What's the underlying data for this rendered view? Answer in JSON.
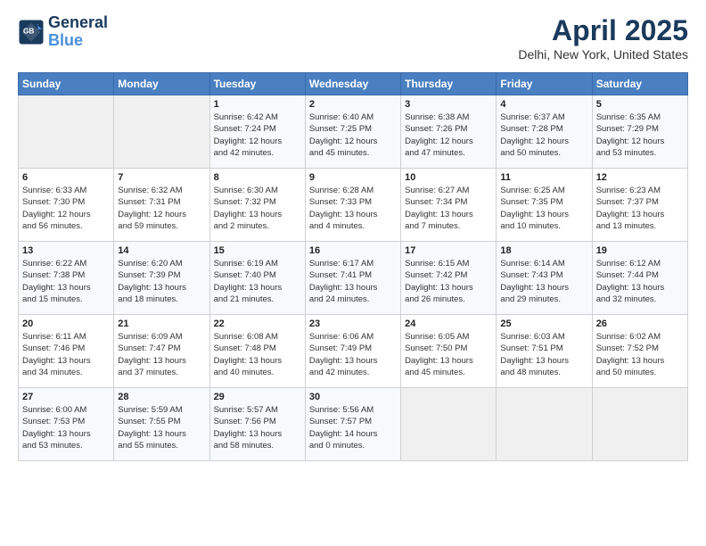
{
  "logo": {
    "line1": "General",
    "line2": "Blue"
  },
  "title": "April 2025",
  "subtitle": "Delhi, New York, United States",
  "days_of_week": [
    "Sunday",
    "Monday",
    "Tuesday",
    "Wednesday",
    "Thursday",
    "Friday",
    "Saturday"
  ],
  "weeks": [
    [
      {
        "day": "",
        "content": ""
      },
      {
        "day": "",
        "content": ""
      },
      {
        "day": "1",
        "content": "Sunrise: 6:42 AM\nSunset: 7:24 PM\nDaylight: 12 hours\nand 42 minutes."
      },
      {
        "day": "2",
        "content": "Sunrise: 6:40 AM\nSunset: 7:25 PM\nDaylight: 12 hours\nand 45 minutes."
      },
      {
        "day": "3",
        "content": "Sunrise: 6:38 AM\nSunset: 7:26 PM\nDaylight: 12 hours\nand 47 minutes."
      },
      {
        "day": "4",
        "content": "Sunrise: 6:37 AM\nSunset: 7:28 PM\nDaylight: 12 hours\nand 50 minutes."
      },
      {
        "day": "5",
        "content": "Sunrise: 6:35 AM\nSunset: 7:29 PM\nDaylight: 12 hours\nand 53 minutes."
      }
    ],
    [
      {
        "day": "6",
        "content": "Sunrise: 6:33 AM\nSunset: 7:30 PM\nDaylight: 12 hours\nand 56 minutes."
      },
      {
        "day": "7",
        "content": "Sunrise: 6:32 AM\nSunset: 7:31 PM\nDaylight: 12 hours\nand 59 minutes."
      },
      {
        "day": "8",
        "content": "Sunrise: 6:30 AM\nSunset: 7:32 PM\nDaylight: 13 hours\nand 2 minutes."
      },
      {
        "day": "9",
        "content": "Sunrise: 6:28 AM\nSunset: 7:33 PM\nDaylight: 13 hours\nand 4 minutes."
      },
      {
        "day": "10",
        "content": "Sunrise: 6:27 AM\nSunset: 7:34 PM\nDaylight: 13 hours\nand 7 minutes."
      },
      {
        "day": "11",
        "content": "Sunrise: 6:25 AM\nSunset: 7:35 PM\nDaylight: 13 hours\nand 10 minutes."
      },
      {
        "day": "12",
        "content": "Sunrise: 6:23 AM\nSunset: 7:37 PM\nDaylight: 13 hours\nand 13 minutes."
      }
    ],
    [
      {
        "day": "13",
        "content": "Sunrise: 6:22 AM\nSunset: 7:38 PM\nDaylight: 13 hours\nand 15 minutes."
      },
      {
        "day": "14",
        "content": "Sunrise: 6:20 AM\nSunset: 7:39 PM\nDaylight: 13 hours\nand 18 minutes."
      },
      {
        "day": "15",
        "content": "Sunrise: 6:19 AM\nSunset: 7:40 PM\nDaylight: 13 hours\nand 21 minutes."
      },
      {
        "day": "16",
        "content": "Sunrise: 6:17 AM\nSunset: 7:41 PM\nDaylight: 13 hours\nand 24 minutes."
      },
      {
        "day": "17",
        "content": "Sunrise: 6:15 AM\nSunset: 7:42 PM\nDaylight: 13 hours\nand 26 minutes."
      },
      {
        "day": "18",
        "content": "Sunrise: 6:14 AM\nSunset: 7:43 PM\nDaylight: 13 hours\nand 29 minutes."
      },
      {
        "day": "19",
        "content": "Sunrise: 6:12 AM\nSunset: 7:44 PM\nDaylight: 13 hours\nand 32 minutes."
      }
    ],
    [
      {
        "day": "20",
        "content": "Sunrise: 6:11 AM\nSunset: 7:46 PM\nDaylight: 13 hours\nand 34 minutes."
      },
      {
        "day": "21",
        "content": "Sunrise: 6:09 AM\nSunset: 7:47 PM\nDaylight: 13 hours\nand 37 minutes."
      },
      {
        "day": "22",
        "content": "Sunrise: 6:08 AM\nSunset: 7:48 PM\nDaylight: 13 hours\nand 40 minutes."
      },
      {
        "day": "23",
        "content": "Sunrise: 6:06 AM\nSunset: 7:49 PM\nDaylight: 13 hours\nand 42 minutes."
      },
      {
        "day": "24",
        "content": "Sunrise: 6:05 AM\nSunset: 7:50 PM\nDaylight: 13 hours\nand 45 minutes."
      },
      {
        "day": "25",
        "content": "Sunrise: 6:03 AM\nSunset: 7:51 PM\nDaylight: 13 hours\nand 48 minutes."
      },
      {
        "day": "26",
        "content": "Sunrise: 6:02 AM\nSunset: 7:52 PM\nDaylight: 13 hours\nand 50 minutes."
      }
    ],
    [
      {
        "day": "27",
        "content": "Sunrise: 6:00 AM\nSunset: 7:53 PM\nDaylight: 13 hours\nand 53 minutes."
      },
      {
        "day": "28",
        "content": "Sunrise: 5:59 AM\nSunset: 7:55 PM\nDaylight: 13 hours\nand 55 minutes."
      },
      {
        "day": "29",
        "content": "Sunrise: 5:57 AM\nSunset: 7:56 PM\nDaylight: 13 hours\nand 58 minutes."
      },
      {
        "day": "30",
        "content": "Sunrise: 5:56 AM\nSunset: 7:57 PM\nDaylight: 14 hours\nand 0 minutes."
      },
      {
        "day": "",
        "content": ""
      },
      {
        "day": "",
        "content": ""
      },
      {
        "day": "",
        "content": ""
      }
    ]
  ]
}
